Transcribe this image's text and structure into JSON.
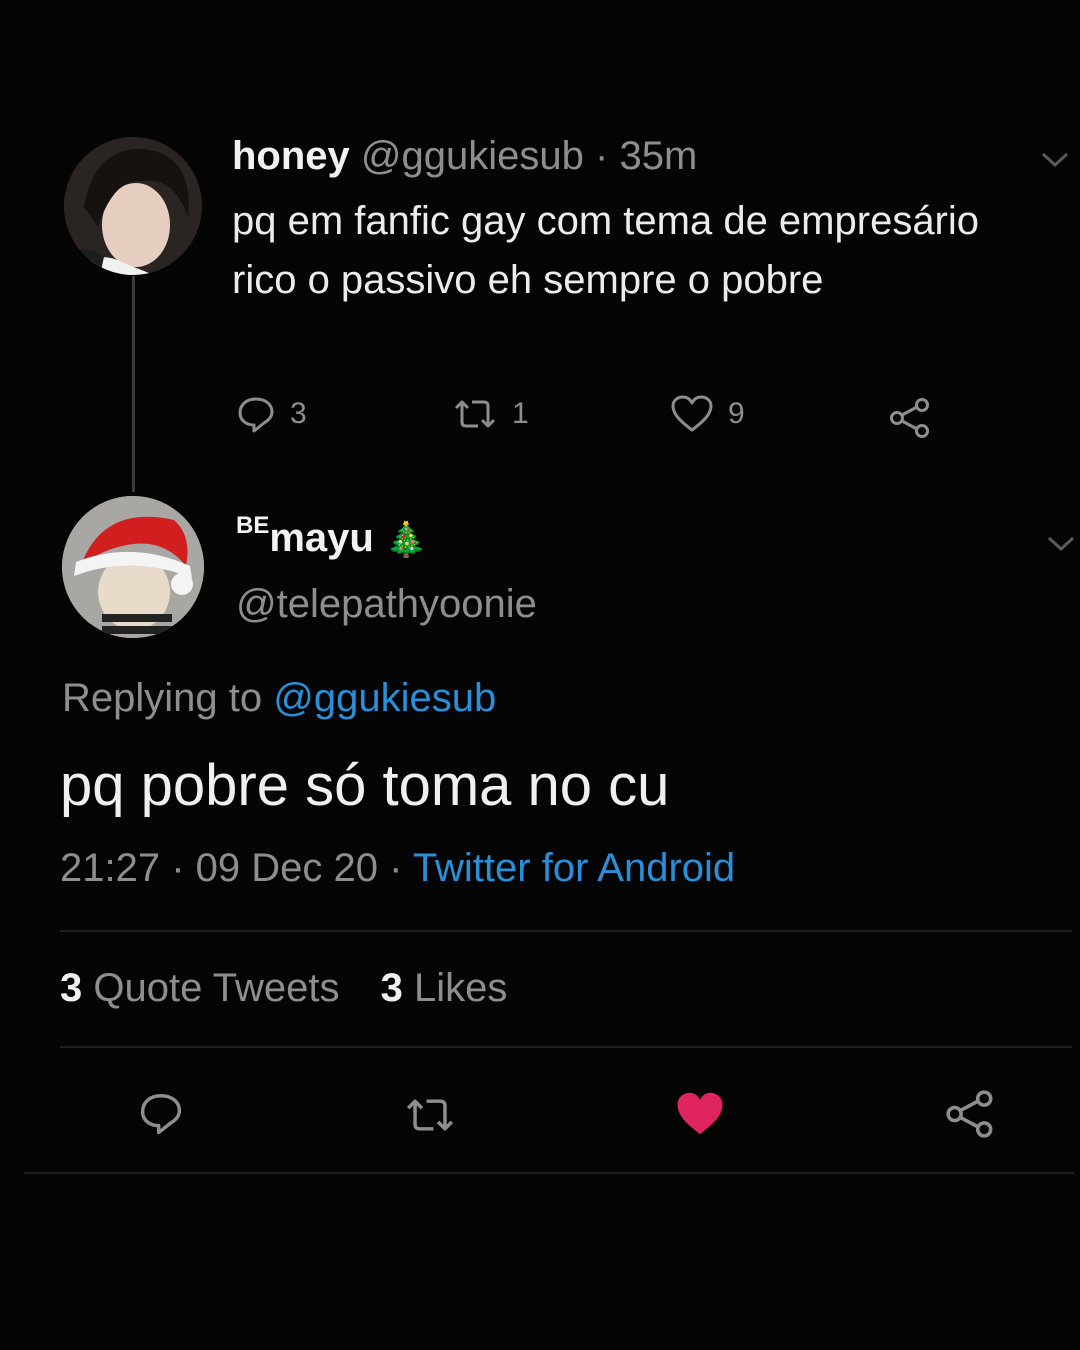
{
  "parent_tweet": {
    "display_name": "honey",
    "handle": "@ggukiesub",
    "separator": "·",
    "time": "35m",
    "text": "pq em fanfic gay com tema de empresário rico o passivo eh sempre o pobre",
    "actions": {
      "replies": "3",
      "retweets": "1",
      "likes": "9"
    }
  },
  "reply_tweet": {
    "display_name_prefix": "BE",
    "display_name": "mayu",
    "display_name_emoji": "🎄",
    "handle": "@telepathyoonie",
    "replying_label": "Replying to",
    "replying_handle": "@ggukiesub",
    "text": "pq pobre só toma no cu",
    "timestamp": "21:27 · 09 Dec 20 · ",
    "source": "Twitter for Android",
    "stats": {
      "quote_count": "3",
      "quote_label": "Quote Tweets",
      "like_count": "3",
      "like_label": "Likes"
    }
  },
  "colors": {
    "background": "#050505",
    "link": "#2a8fd8",
    "liked": "#e0245e",
    "muted": "#8e8e8e"
  },
  "icons": [
    "reply-icon",
    "retweet-icon",
    "heart-icon",
    "share-icon",
    "chevron-down-icon"
  ]
}
